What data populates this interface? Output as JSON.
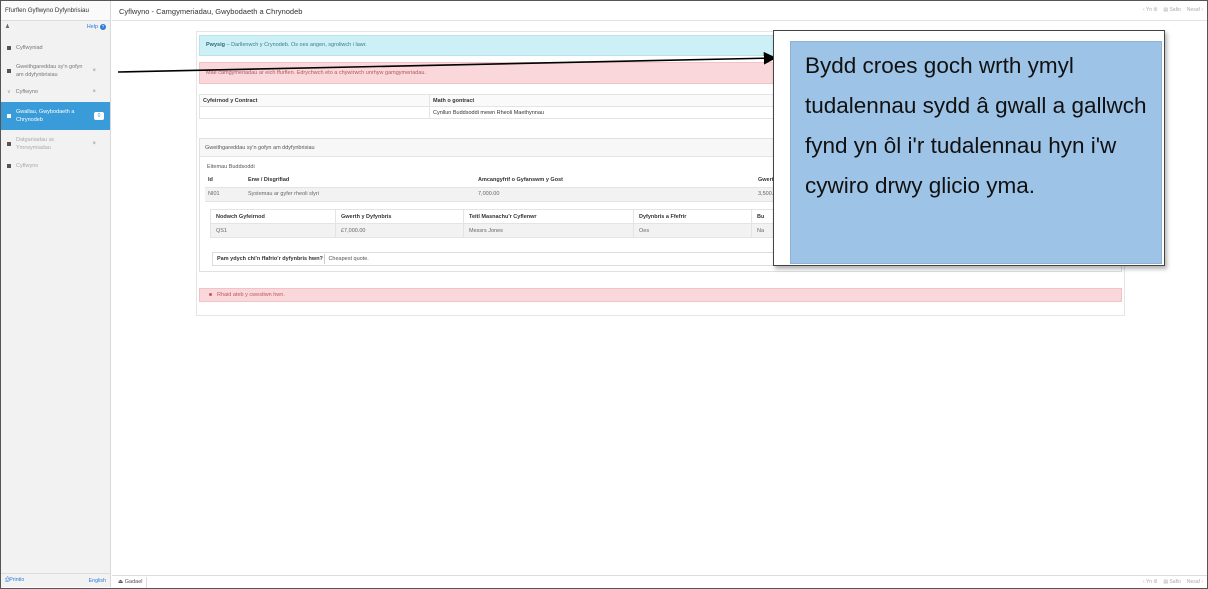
{
  "sidebar": {
    "title": "Ffurflen Gyflwyno Dyfynbrisiau",
    "user_icon": "person-icon",
    "help_label": "Help",
    "items": [
      {
        "label": "Cyflwyniad",
        "state": "normal"
      },
      {
        "label": "Gweithgareddau sy'n gofyn am ddyfynbrisiau",
        "state": "error"
      },
      {
        "label": "Cyflwyno",
        "state": "group"
      },
      {
        "label": "Gwallau, Gwybodaeth a Chrynodeb",
        "state": "active"
      },
      {
        "label": "Datganiadau ac Ymrwymiadau",
        "state": "error"
      },
      {
        "label": "Cyflwyno",
        "state": "normal"
      }
    ],
    "badge": "0",
    "footer_print": "Printio",
    "footer_lang": "English"
  },
  "header": {
    "title": "Cyflwyno - Camgymeriadau, Gwybodaeth a Chrynodeb",
    "nav_back": "Yn ôl",
    "nav_save": "Safio",
    "nav_next": "Nesaf"
  },
  "main": {
    "info_strong": "Pwysig",
    "info_text": " – Darllenwch y Crynodeb. Os oes angen, sgroliwch i lawr.",
    "error_text": "Mae camgymeriadau ar eich ffurflen. Edrychwch eto a chywirwch unrhyw gamgymeriadau.",
    "contract": {
      "col1": "Cyfeirnod y Contract",
      "col2": "Math o gontract",
      "val1": "",
      "val2": "Cynllun Buddsoddi mewn Rheoli Maethynnau"
    },
    "panel_title": "Gweithgareddau sy'n gofyn am ddyfynbrisiau",
    "sub_label": "Eitemau Buddsoddi",
    "grid": {
      "headers": [
        "Id",
        "Enw / Disgrifiad",
        "Amcangyfrif o Gyfanswm y Gost",
        "Gwerth"
      ],
      "row": [
        "NI01",
        "Systemau ar gyfer rheoli slyri",
        "7,000.00",
        "3,500.00"
      ]
    },
    "nested": {
      "headers": [
        "Nodwch Gyfeirnod",
        "Gwerth y Dyfynbris",
        "Teitl Masnachu'r Cyflenwr",
        "Dyfynbris a Ffefrir",
        "Bu"
      ],
      "row": [
        "QS1",
        "£7,000.00",
        "Messrs Jones",
        "Oes",
        "Na"
      ]
    },
    "question_label": "Pam ydych chi'n ffafrio'r dyfynbris hwn?",
    "question_value": "Cheapest quote.",
    "row_error": "Rhaid ateb y cwestiwn hwn."
  },
  "footer": {
    "exit_label": "Gadael",
    "nav_back": "Yn ôl",
    "nav_save": "Safio",
    "nav_next": "Nesaf"
  },
  "callout": {
    "text": "Bydd croes goch wrth ymyl tudalennau sydd â gwall a gallwch fynd yn ôl i'r tudalennau hyn i'w cywiro drwy glicio yma."
  },
  "colors": {
    "active_item": "#3a9bd9",
    "info_bg": "#cdeff6",
    "error_bg": "#f9d7da",
    "callout_bg": "#9dc3e6"
  }
}
